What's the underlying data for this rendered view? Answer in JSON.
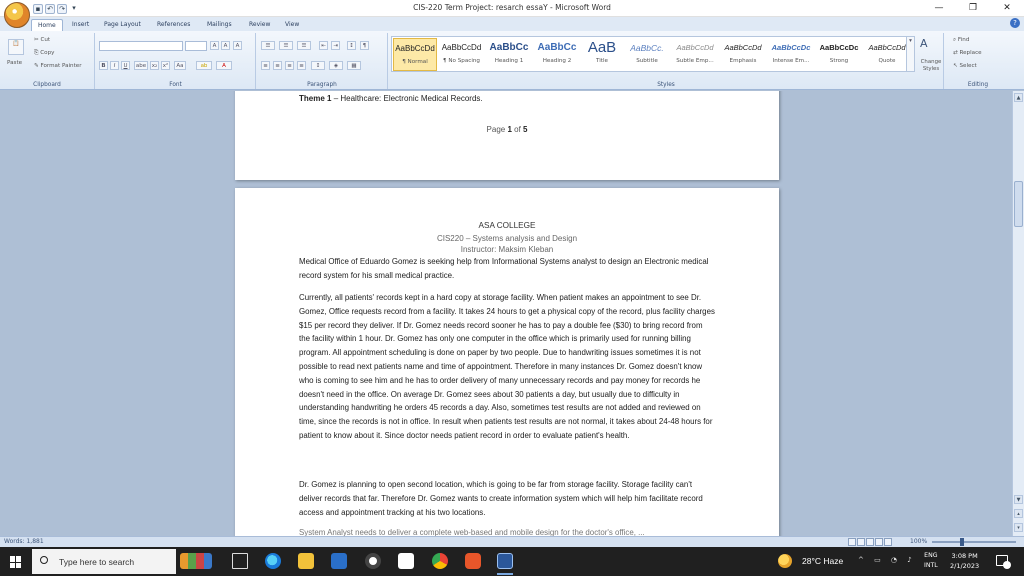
{
  "window": {
    "title": "CIS-220 Term Project: resarch essaY - Microsoft Word",
    "controls": {
      "minimize": "—",
      "restore": "❐",
      "close": "✕"
    }
  },
  "quick_access": [
    "save-icon",
    "undo-icon",
    "redo-icon",
    "customize-icon"
  ],
  "tabs": [
    "Home",
    "Insert",
    "Page Layout",
    "References",
    "Mailings",
    "Review",
    "View"
  ],
  "ribbon": {
    "clipboard": {
      "label": "Clipboard",
      "paste": "Paste",
      "cut": "Cut",
      "copy": "Copy",
      "format_painter": "Format Painter"
    },
    "font": {
      "label": "Font",
      "bold": "B",
      "italic": "I",
      "underline": "U",
      "strike": "abe",
      "subscript": "x₂",
      "superscript": "x²",
      "change_case": "Aa",
      "grow": "A",
      "shrink": "A",
      "clear": "A"
    },
    "paragraph": {
      "label": "Paragraph"
    },
    "styles": {
      "label": "Styles",
      "items": [
        {
          "sample": "AaBbCcDd",
          "name": "¶ Normal"
        },
        {
          "sample": "AaBbCcDd",
          "name": "¶ No Spacing"
        },
        {
          "sample": "AaBbCc",
          "name": "Heading 1"
        },
        {
          "sample": "AaBbCc",
          "name": "Heading 2"
        },
        {
          "sample": "AaB",
          "name": "Title"
        },
        {
          "sample": "AaBbCc.",
          "name": "Subtitle"
        },
        {
          "sample": "AaBbCcDd",
          "name": "Subtle Emp..."
        },
        {
          "sample": "AaBbCcDd",
          "name": "Emphasis"
        },
        {
          "sample": "AaBbCcDc",
          "name": "Intense Em..."
        },
        {
          "sample": "AaBbCcDc",
          "name": "Strong"
        },
        {
          "sample": "AaBbCcDd",
          "name": "Quote"
        }
      ],
      "change_styles": "Change Styles"
    },
    "editing": {
      "label": "Editing",
      "find": "Find",
      "replace": "Replace",
      "select": "Select"
    }
  },
  "document": {
    "page1": {
      "theme_label": "Theme 1",
      "theme_text": " – Healthcare: Electronic Medical Records.",
      "page_prefix": "Page ",
      "page_current": "1",
      "page_of": " of ",
      "page_total": "5"
    },
    "page2": {
      "school": "ASA COLLEGE",
      "course": "CIS220 – Systems analysis and Design",
      "instructor": "Instructor: Maksim Kleban",
      "para1": "Medical Office of Eduardo Gomez is seeking help from Informational Systems analyst to design an Electronic medical record system for his small medical practice.",
      "para2": "Currently, all patients' records kept in a hard copy at storage facility. When patient makes an appointment to see Dr. Gomez, Office requests record from a facility. It takes 24 hours to get a physical copy of the record, plus facility charges $15 per record they deliver.  If Dr. Gomez needs record sooner he has to pay a double fee ($30) to bring record from the facility within 1 hour. Dr. Gomez has only one computer in the office which is primarily used for running billing program.  All appointment scheduling is done on paper by two people. Due to handwriting issues sometimes it is not possible to read next patients name and time of appointment.  Therefore in many instances Dr. Gomez doesn't know who is coming to see him and he has to order delivery of many unnecessary records and pay money for records he doesn't need in the office. On average Dr. Gomez sees about 30 patients a day, but usually due to difficulty in understanding  handwriting he orders 45 records a day. Also, sometimes test results are not added and reviewed on time, since the records is not in office. In result when patients test results are not normal, it takes about 24-48 hours for patient to know about it. Since doctor needs patient record in order to evaluate patient's health.",
      "para3": "Dr. Gomez is planning to open second location, which is going to be far from storage facility.  Storage facility can't deliver records that far. Therefore Dr. Gomez wants to create information system which will help him facilitate record access and appointment tracking at his two locations.",
      "para4": "System Analyst needs to deliver a complete web-based and mobile design for the doctor's office, ..."
    }
  },
  "statusbar": {
    "words": "Words: 1,881",
    "zoom": "100%"
  },
  "taskbar": {
    "search_placeholder": "Type here to search",
    "weather": "28°C  Haze",
    "lang_line1": "ENG",
    "lang_line2": "INTL",
    "time": "3:08 PM",
    "date": "2/1/2023"
  }
}
